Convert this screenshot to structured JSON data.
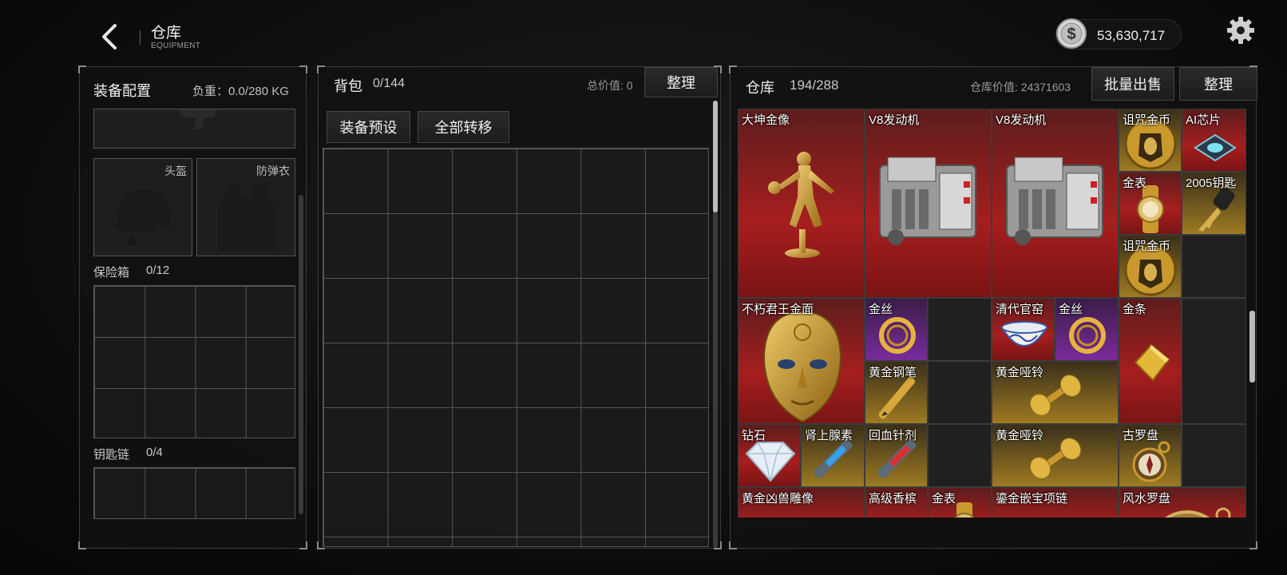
{
  "header": {
    "title": "仓库",
    "subtitle": "EQUIPMENT",
    "currency_value": "53,630,717",
    "currency_icon": "dollar-coin-icon",
    "settings_icon": "gear-icon",
    "back_icon": "chevron-left-icon"
  },
  "left_panel": {
    "title": "装备配置",
    "weight_label": "负重：0.0/280 KG",
    "slots": [
      {
        "label": "头盔",
        "icon": "helmet-icon"
      },
      {
        "label": "防弹衣",
        "icon": "vest-icon"
      }
    ],
    "safe_box": {
      "label": "保险箱",
      "count": "0/12"
    },
    "keychain": {
      "label": "钥匙链",
      "count": "0/4"
    }
  },
  "backpack": {
    "title": "背包",
    "count": "0/144",
    "total_value_label": "总价值: 0",
    "sort_button": "整理",
    "preset_button": "装备预设",
    "transfer_all_button": "全部转移"
  },
  "warehouse": {
    "title": "仓库",
    "count": "194/288",
    "value_label": "仓库价值: 24371603",
    "bulk_sell_button": "批量出售",
    "sort_button": "整理",
    "items": [
      {
        "name": "大坤金像",
        "rarity": "red",
        "icon": "gold-statue-icon"
      },
      {
        "name": "V8发动机",
        "rarity": "red",
        "icon": "engine-icon"
      },
      {
        "name": "V8发动机",
        "rarity": "red",
        "icon": "engine-icon"
      },
      {
        "name": "诅咒金币",
        "rarity": "gold",
        "icon": "pharaoh-coin-icon"
      },
      {
        "name": "AI芯片",
        "rarity": "red",
        "icon": "chip-icon"
      },
      {
        "name": "金表",
        "rarity": "red",
        "icon": "gold-watch-icon"
      },
      {
        "name": "2005钥匙",
        "rarity": "gold",
        "icon": "key-icon"
      },
      {
        "name": "诅咒金币",
        "rarity": "gold",
        "icon": "pharaoh-coin-icon"
      },
      {
        "name": "不朽君王金面",
        "rarity": "red",
        "icon": "gold-mask-icon"
      },
      {
        "name": "金丝",
        "rarity": "purple",
        "icon": "gold-wire-icon"
      },
      {
        "name": "清代官窑",
        "rarity": "red",
        "icon": "porcelain-bowl-icon"
      },
      {
        "name": "金丝",
        "rarity": "purple",
        "icon": "gold-wire-icon"
      },
      {
        "name": "金条",
        "rarity": "red",
        "icon": "gold-bar-icon"
      },
      {
        "name": "黄金钢笔",
        "rarity": "gold",
        "icon": "gold-pen-icon"
      },
      {
        "name": "黄金哑铃",
        "rarity": "gold",
        "icon": "gold-dumbbell-icon"
      },
      {
        "name": "钻石",
        "rarity": "red",
        "icon": "diamond-icon"
      },
      {
        "name": "肾上腺素",
        "rarity": "gold",
        "icon": "syringe-icon"
      },
      {
        "name": "回血针剂",
        "rarity": "gold",
        "icon": "syringe-icon"
      },
      {
        "name": "黄金哑铃",
        "rarity": "gold",
        "icon": "gold-dumbbell-icon"
      },
      {
        "name": "古罗盘",
        "rarity": "gold",
        "icon": "compass-icon"
      },
      {
        "name": "黄金凶兽雕像",
        "rarity": "red",
        "icon": "beast-statue-icon"
      },
      {
        "name": "高级香槟",
        "rarity": "red",
        "icon": "champagne-icon"
      },
      {
        "name": "金表",
        "rarity": "red",
        "icon": "gold-watch-icon"
      },
      {
        "name": "鎏金嵌宝项链",
        "rarity": "red",
        "icon": "necklace-icon"
      },
      {
        "name": "风水罗盘",
        "rarity": "red",
        "icon": "compass-icon"
      }
    ]
  }
}
